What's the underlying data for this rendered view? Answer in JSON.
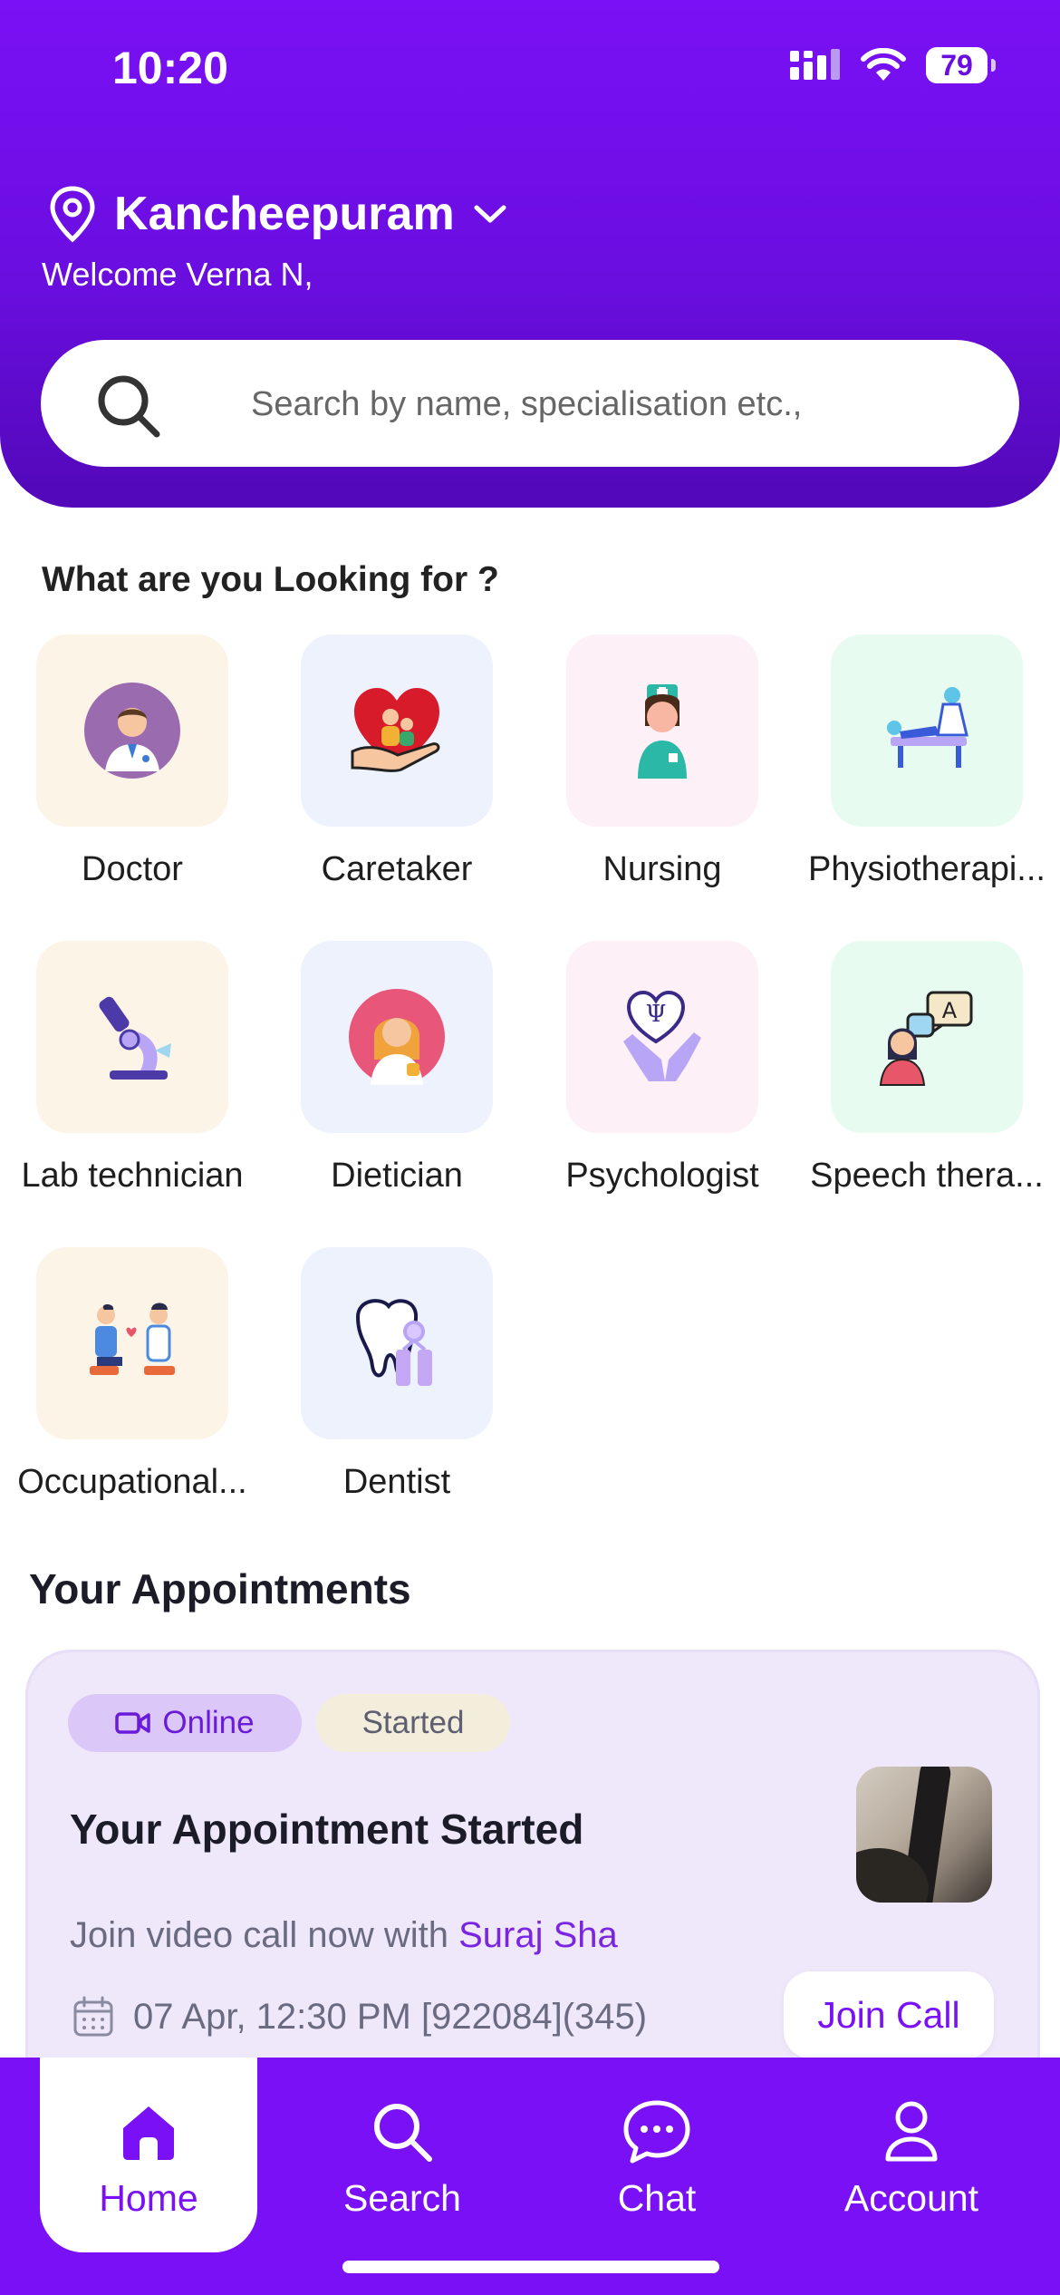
{
  "status_bar": {
    "time": "10:20",
    "battery": "79"
  },
  "header": {
    "location": "Kancheepuram",
    "welcome": "Welcome Verna N,",
    "search_placeholder": "Search by name, specialisation etc.,"
  },
  "categories_section": {
    "title": "What are you Looking for ?",
    "items": [
      {
        "label": "Doctor",
        "icon": "doctor-icon",
        "tile_color": "#fdf4e8"
      },
      {
        "label": "Caretaker",
        "icon": "caretaker-icon",
        "tile_color": "#eef2fd"
      },
      {
        "label": "Nursing",
        "icon": "nurse-icon",
        "tile_color": "#fdf0f6"
      },
      {
        "label": "Physiotherapi...",
        "icon": "physiotherapy-icon",
        "tile_color": "#e8fbf1"
      },
      {
        "label": "Lab technician",
        "icon": "microscope-icon",
        "tile_color": "#fdf4e8"
      },
      {
        "label": "Dietician",
        "icon": "dietician-icon",
        "tile_color": "#eef2fd"
      },
      {
        "label": "Psychologist",
        "icon": "psychology-icon",
        "tile_color": "#fdf0f6"
      },
      {
        "label": "Speech thera...",
        "icon": "speech-therapy-icon",
        "tile_color": "#e8fbf1"
      },
      {
        "label": "Occupational...",
        "icon": "occupational-therapy-icon",
        "tile_color": "#fdf4e8"
      },
      {
        "label": "Dentist",
        "icon": "tooth-icon",
        "tile_color": "#eef2fd"
      }
    ]
  },
  "appointments": {
    "title": "Your Appointments",
    "card": {
      "mode_chip": "Online",
      "status_chip": "Started",
      "heading": "Your Appointment Started",
      "join_text": "Join video call now with ",
      "doctor_name": "Suraj Sha",
      "datetime": "07 Apr, 12:30 PM [922084](345)",
      "join_button": "Join Call"
    }
  },
  "tab_bar": {
    "items": [
      {
        "label": "Home",
        "icon": "home-icon",
        "active": true
      },
      {
        "label": "Search",
        "icon": "search-icon",
        "active": false
      },
      {
        "label": "Chat",
        "icon": "chat-icon",
        "active": false
      },
      {
        "label": "Account",
        "icon": "account-icon",
        "active": false
      }
    ]
  },
  "colors": {
    "brand": "#7a10f5",
    "accent_text": "#7a25e0"
  }
}
